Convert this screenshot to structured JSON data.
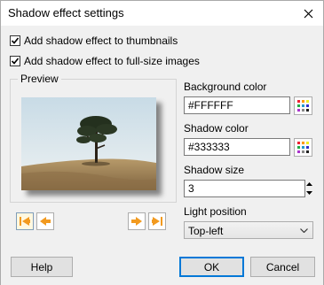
{
  "window": {
    "title": "Shadow effect settings"
  },
  "options": {
    "thumbnails": {
      "label": "Add shadow effect to thumbnails",
      "checked": true
    },
    "fullsize": {
      "label": "Add shadow effect to full-size images",
      "checked": true
    }
  },
  "preview": {
    "label": "Preview"
  },
  "background": {
    "label": "Background color",
    "value": "#FFFFFF"
  },
  "shadow_color": {
    "label": "Shadow color",
    "value": "#333333"
  },
  "shadow_size": {
    "label": "Shadow size",
    "value": "3"
  },
  "light_position": {
    "label": "Light position",
    "value": "Top-left"
  },
  "buttons": {
    "help": "Help",
    "ok": "OK",
    "cancel": "Cancel"
  },
  "colors": {
    "accent": "#0078d7",
    "nav_arrow": "#f29a1f"
  }
}
